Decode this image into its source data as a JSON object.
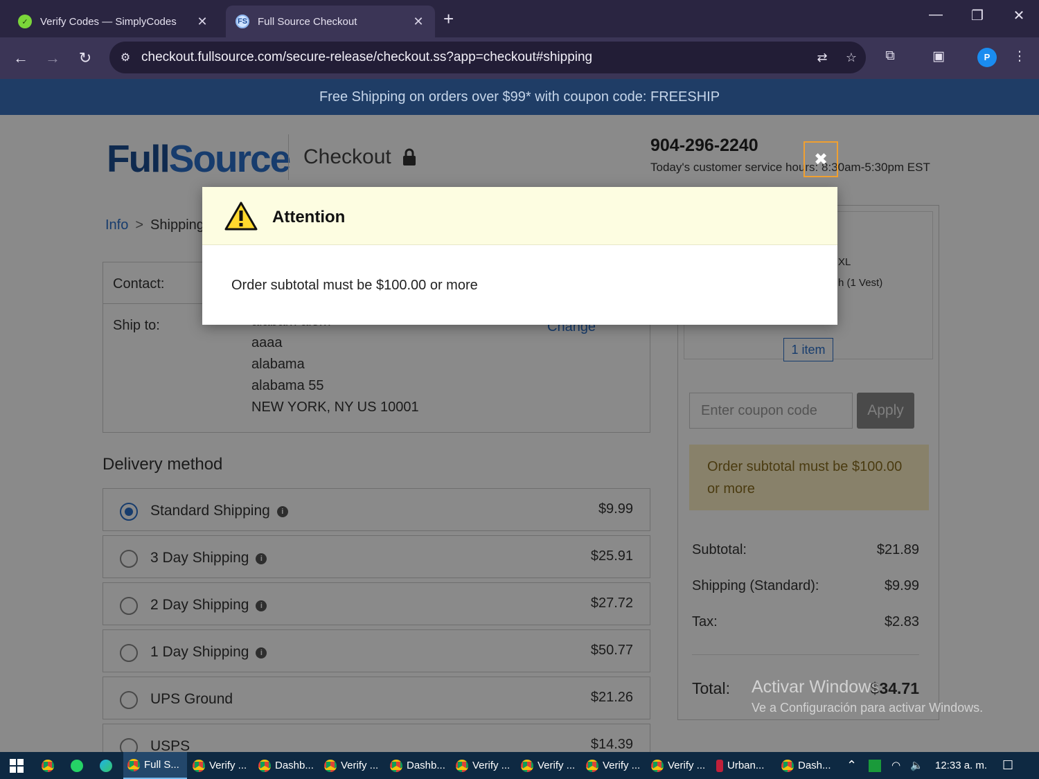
{
  "browser": {
    "tabs": [
      {
        "title": "Verify Codes — SimplyCodes",
        "favicon": "simplycodes-icon",
        "close": "✕"
      },
      {
        "title": "Full Source Checkout",
        "favicon": "FS",
        "close": "✕"
      }
    ],
    "new_tab": "+",
    "url": "checkout.fullsource.com/secure-release/checkout.ss?app=checkout#shipping",
    "profile_initial": "P"
  },
  "page": {
    "promo": "Free Shipping on orders over $99* with coupon code: FREESHIP",
    "logo": {
      "part1": "Full",
      "part2": "Source"
    },
    "checkout_title": "Checkout",
    "phone": "904-296-2240",
    "hours": "Today's customer service hours: 8:30am-5:30pm EST",
    "breadcrumb": {
      "info": "Info",
      "sep": ">",
      "shipping": "Shipping"
    },
    "contact_label": "Contact:",
    "ship_to_label": "Ship to:",
    "address_lines": [
      "alabam alom",
      "aaaa",
      "alabama",
      "alabama 55",
      "NEW YORK, NY US 10001"
    ],
    "change_link": "Change",
    "delivery_title": "Delivery method",
    "shipping_options": [
      {
        "name": "Standard Shipping",
        "price": "$9.99",
        "selected": true,
        "info": true
      },
      {
        "name": "3 Day Shipping",
        "price": "$25.91",
        "selected": false,
        "info": true
      },
      {
        "name": "2 Day Shipping",
        "price": "$27.72",
        "selected": false,
        "info": true
      },
      {
        "name": "1 Day Shipping",
        "price": "$50.77",
        "selected": false,
        "info": true
      },
      {
        "name": "UPS Ground",
        "price": "$21.26",
        "selected": false,
        "info": false
      },
      {
        "name": "USPS",
        "price": "$14.39",
        "selected": false,
        "info": false
      }
    ],
    "summary": {
      "cart_lines": [
        "XL",
        "h (1 Vest)"
      ],
      "items_badge": "1 item",
      "coupon_placeholder": "Enter coupon code",
      "apply_label": "Apply",
      "warning": "Order subtotal must be $100.00 or more",
      "subtotal_label": "Subtotal:",
      "subtotal": "$21.89",
      "shipping_label": "Shipping (Standard):",
      "shipping": "$9.99",
      "tax_label": "Tax:",
      "tax": "$2.83",
      "total_label": "Total:",
      "total": "$34.71"
    }
  },
  "modal": {
    "title": "Attention",
    "message": "Order subtotal must be $100.00 or more",
    "close_glyph": "✖"
  },
  "watermark": {
    "title": "Activar Windows",
    "subtitle": "Ve a Configuración para activar Windows."
  },
  "taskbar": {
    "apps": [
      {
        "label": "Full S...",
        "active": true
      },
      {
        "label": "Verify ...",
        "active": false
      },
      {
        "label": "Dashb...",
        "active": false
      },
      {
        "label": "Verify ...",
        "active": false
      },
      {
        "label": "Dashb...",
        "active": false
      },
      {
        "label": "Verify ...",
        "active": false
      },
      {
        "label": "Verify ...",
        "active": false
      },
      {
        "label": "Verify ...",
        "active": false
      },
      {
        "label": "Verify ...",
        "active": false
      },
      {
        "label": "Urban...",
        "active": false
      },
      {
        "label": "Dash...",
        "active": false
      }
    ],
    "clock": "12:33 a. m."
  },
  "colors": {
    "brand_blue": "#1d4f93",
    "link_blue": "#2b70c9",
    "promo_bg": "#1f3d66",
    "warning_bg": "#fbeec5",
    "modal_head_bg": "#fdfde1",
    "close_highlight": "#f0a030"
  }
}
